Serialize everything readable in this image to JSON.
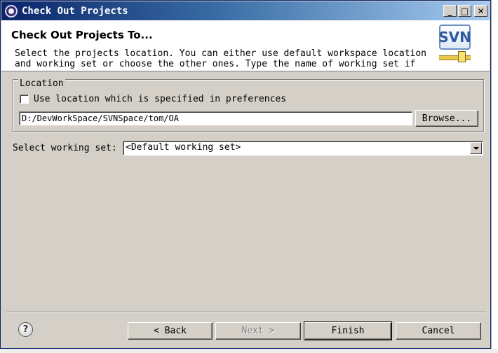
{
  "window": {
    "title": "Check Out Projects",
    "controls": {
      "minimize": "_",
      "maximize": "□",
      "close": "✕"
    }
  },
  "header": {
    "title": "Check Out Projects To...",
    "description": "Select the projects location. You can either use default workspace location and working set or choose the other ones. Type the name of working set if",
    "logo_text": "SVN"
  },
  "location": {
    "group_label": "Location",
    "use_preferences_label": "Use location which is specified in preferences",
    "use_preferences_checked": false,
    "path_value": "D:/DevWorkSpace/SVNSpace/tom/OA",
    "browse_label": "Browse..."
  },
  "working_set": {
    "label": "Select working set:",
    "selected": "<Default working set>"
  },
  "footer": {
    "help_icon": "?",
    "back_label": "< Back",
    "next_label": "Next >",
    "finish_label": "Finish",
    "cancel_label": "Cancel"
  },
  "colors": {
    "titlebar_start": "#0a246a",
    "titlebar_end": "#a6caf0",
    "dialog_bg": "#d4d0c8",
    "disabled_text": "#808080"
  }
}
